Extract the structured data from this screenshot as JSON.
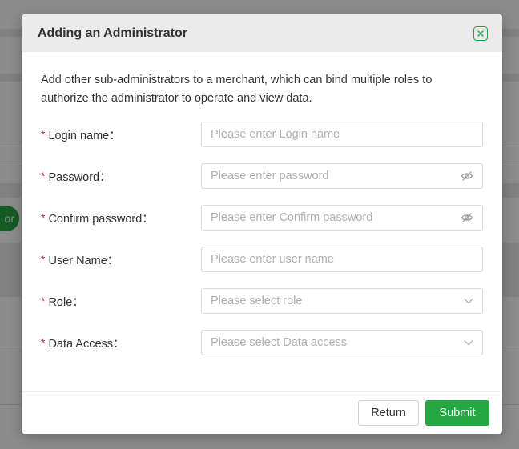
{
  "background": {
    "partial_button_label": "or"
  },
  "dialog": {
    "title": "Adding an Administrator",
    "description": "Add other sub-administrators to a merchant, which can bind multiple roles to authorize the administrator to operate and view data.",
    "required_marker": "*",
    "fields": [
      {
        "label": "Login name：",
        "placeholder": "Please enter Login name",
        "type": "text",
        "icon": null
      },
      {
        "label": "Password：",
        "placeholder": "Please enter password",
        "type": "password",
        "icon": "eye-hidden-icon"
      },
      {
        "label": "Confirm password：",
        "placeholder": "Please enter Confirm password",
        "type": "password",
        "icon": "eye-hidden-icon"
      },
      {
        "label": "User Name：",
        "placeholder": "Please enter user name",
        "type": "text",
        "icon": null
      },
      {
        "label": "Role：",
        "placeholder": "Please select role",
        "type": "select",
        "icon": "chevron-down-icon"
      },
      {
        "label": "Data Access：",
        "placeholder": "Please select Data access",
        "type": "select",
        "icon": "chevron-down-icon"
      }
    ],
    "buttons": {
      "return_label": "Return",
      "submit_label": "Submit"
    }
  },
  "colors": {
    "accent": "#27a744",
    "required": "#e02020",
    "header_bg": "#ebebeb"
  }
}
